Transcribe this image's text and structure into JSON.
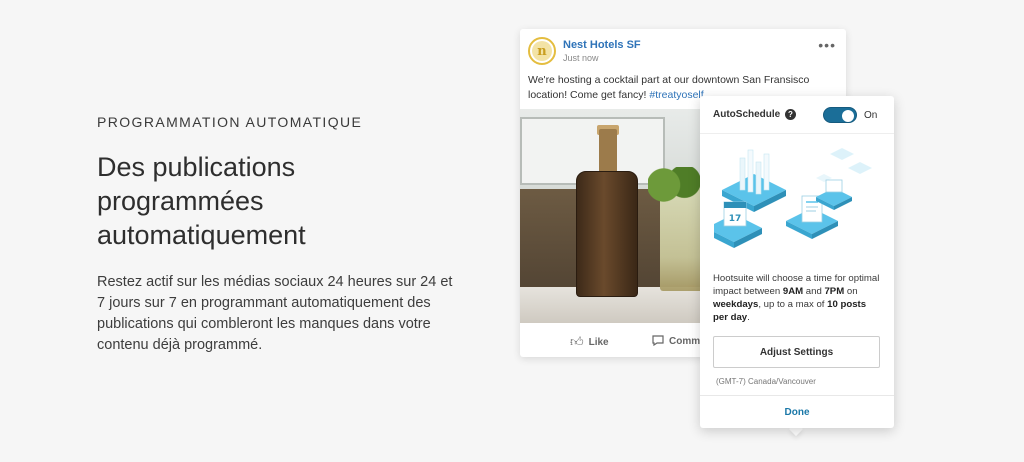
{
  "feature": {
    "eyebrow": "PROGRAMMATION AUTOMATIQUE",
    "headline": "Des publications programmées automatiquement",
    "body": "Restez actif sur les médias sociaux 24 heures sur 24 et 7 jours sur 7 en programmant automatiquement des publications qui combleront les manques dans votre contenu déjà programmé."
  },
  "post": {
    "avatar_letter": "n",
    "page_name": "Nest Hotels SF",
    "time": "Just now",
    "more_icon": "ellipsis-icon",
    "text": "We're hosting a cocktail part at our downtown San Fransisco location! Come get fancy! ",
    "hashtag": "#treatyoself",
    "actions": {
      "like": "Like",
      "like_icon": "thumbs-up-icon",
      "comment": "Comm",
      "comment_icon": "comment-icon"
    }
  },
  "autoschedule": {
    "title": "AutoSchedule",
    "help_icon": "?",
    "toggle_state": "On",
    "calendar_day": "17",
    "description": {
      "part1": "Hootsuite will choose a time for optimal impact between ",
      "start_time": "9AM",
      "part2": " and ",
      "end_time": "7PM",
      "part3": " on ",
      "days": "weekdays",
      "part4": ", up to a max of ",
      "max_posts": "10 posts per day",
      "part5": "."
    },
    "adjust_button": "Adjust Settings",
    "timezone": "(GMT-7) Canada/Vancouver",
    "done_button": "Done"
  },
  "colors": {
    "background": "#f6f6f6",
    "link_blue": "#2e73b8",
    "toggle_on": "#1b6e98",
    "illustration_blue": "#5bc3ea"
  }
}
